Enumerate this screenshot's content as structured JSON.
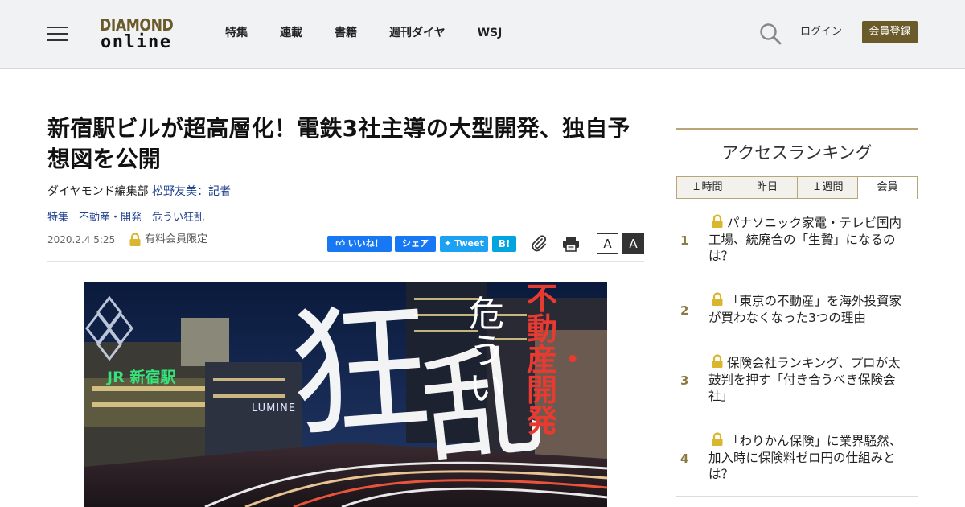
{
  "header": {
    "logo_top": "DIAMOND",
    "logo_bottom": "online",
    "nav": [
      "特集",
      "連載",
      "書籍",
      "週刊ダイヤ",
      "WSJ"
    ],
    "login": "ログイン",
    "register": "会員登録",
    "icons": {
      "menu": "hamburger-icon",
      "search": "search-icon"
    }
  },
  "article": {
    "title": "新宿駅ビルが超高層化！電鉄3社主導の大型開発、独自予想図を公開",
    "byline_org": "ダイヤモンド編集部",
    "byline_author": "松野友美：記者",
    "tags": [
      "特集",
      "不動産・開発",
      "危うい狂乱"
    ],
    "date": "2020.2.4 5:25",
    "member_only": "有料会員限定",
    "share": {
      "like": "いいね！",
      "share": "シェア",
      "tweet": "Tweet",
      "hatena": "B!"
    },
    "font_small": "A",
    "font_large": "A",
    "hero": {
      "big1": "狂",
      "big2": "乱",
      "vertical1": "危うい",
      "vertical2": "不動産・開発",
      "station_sign": "JR 新宿駅",
      "building_sign": "LUMINE"
    },
    "colors": {
      "accent": "#6b5a2a",
      "link": "#1d3f8f",
      "facebook": "#1877f2",
      "twitter": "#1da1f2",
      "hatena": "#00a4de"
    }
  },
  "sidebar": {
    "title": "アクセスランキング",
    "tabs": [
      "１時間",
      "昨日",
      "１週間",
      "会員"
    ],
    "active_tab": "会員",
    "ranking": [
      {
        "rank": "1",
        "locked": true,
        "text": "パナソニック家電・テレビ国内工場、統廃合の「生贄」になるのは？"
      },
      {
        "rank": "2",
        "locked": true,
        "text": "「東京の不動産」を海外投資家が買わなくなった3つの理由"
      },
      {
        "rank": "3",
        "locked": true,
        "text": "保険会社ランキング、プロが太鼓判を押す「付き合うべき保険会社」"
      },
      {
        "rank": "4",
        "locked": true,
        "text": "「わりかん保険」に業界騒然、加入時に保険料ゼロ円の仕組みとは？"
      }
    ]
  }
}
